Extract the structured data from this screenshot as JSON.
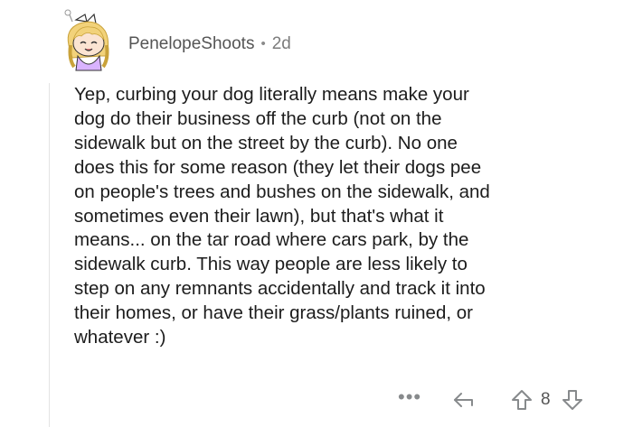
{
  "comment": {
    "author": "PenelopeShoots",
    "separator": "•",
    "age": "2d",
    "avatar_icon": "snoo-avatar-icon",
    "body_lines": [
      "Yep, curbing your dog literally means make your",
      "dog do their business off the curb (not on the",
      "sidewalk but on the street by the curb). No one",
      "does this for some reason (they let their dogs pee",
      "on people's trees and bushes on the sidewalk, and",
      "sometimes even their lawn), but that's what it",
      "means... on the tar road where cars park, by the",
      "sidewalk curb. This way people are less likely to",
      "step on any remnants  accidentally and track it into",
      "their homes, or have their grass/plants ruined, or",
      "whatever :)"
    ]
  },
  "actions": {
    "more_label": "•••",
    "more_icon": "more-options-icon",
    "reply_icon": "reply-icon",
    "upvote_icon": "upvote-arrow-icon",
    "score": "8",
    "downvote_icon": "downvote-arrow-icon"
  },
  "colors": {
    "icon_gray": "#878a8c",
    "text": "#1c1c1c",
    "meta": "#555555"
  }
}
